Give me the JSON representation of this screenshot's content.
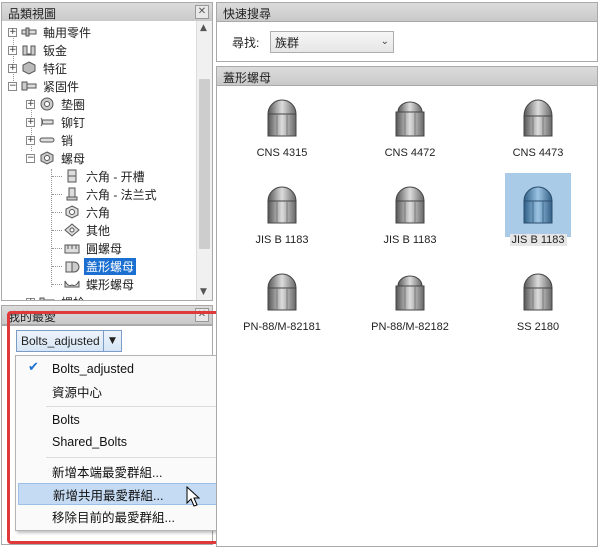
{
  "tree_panel": {
    "title": "品類視圖",
    "items": [
      {
        "label": "軸用零件",
        "icon": "shaft-part-icon"
      },
      {
        "label": "钣金",
        "icon": "sheet-metal-icon"
      },
      {
        "label": "特征",
        "icon": "feature-icon"
      },
      {
        "label": "紧固件",
        "icon": "fastener-icon"
      },
      {
        "label": "垫圈",
        "icon": "washer-icon"
      },
      {
        "label": "铆钉",
        "icon": "rivet-icon"
      },
      {
        "label": "销",
        "icon": "pin-icon"
      },
      {
        "label": "螺母",
        "icon": "nut-icon"
      },
      {
        "label": "六角 - 开槽",
        "icon": "slotted-hex-nut-icon"
      },
      {
        "label": "六角 - 法兰式",
        "icon": "flange-hex-nut-icon"
      },
      {
        "label": "六角",
        "icon": "hex-nut-icon"
      },
      {
        "label": "其他",
        "icon": "other-nut-icon"
      },
      {
        "label": "圓螺母",
        "icon": "round-nut-icon"
      },
      {
        "label": "盖形螺母",
        "icon": "cap-nut-icon"
      },
      {
        "label": "蝶形螺母",
        "icon": "wing-nut-icon"
      },
      {
        "label": "螺栓",
        "icon": "bolt-icon"
      }
    ]
  },
  "favorites_panel": {
    "title": "我的最愛",
    "selected": "Bolts_adjusted",
    "menu": {
      "items": [
        "Bolts_adjusted",
        "資源中心",
        "Bolts",
        "Shared_Bolts",
        "新增本端最愛群組...",
        "新增共用最愛群組...",
        "移除目前的最愛群組..."
      ]
    }
  },
  "search_panel": {
    "title": "快速搜尋",
    "find_label": "尋找:",
    "family_value": "族群"
  },
  "results_panel": {
    "title": "蓋形螺母",
    "parts": [
      "CNS 4315",
      "CNS 4472",
      "CNS 4473",
      "JIS B 1183",
      "JIS B 1183",
      "JIS B 1183",
      "PN-88/M-82181",
      "PN-88/M-82182",
      "SS 2180"
    ]
  },
  "colors": {
    "selection": "#1a6fd0",
    "highlight": "#c5dbf3",
    "annotation_box": "#e0393b"
  }
}
